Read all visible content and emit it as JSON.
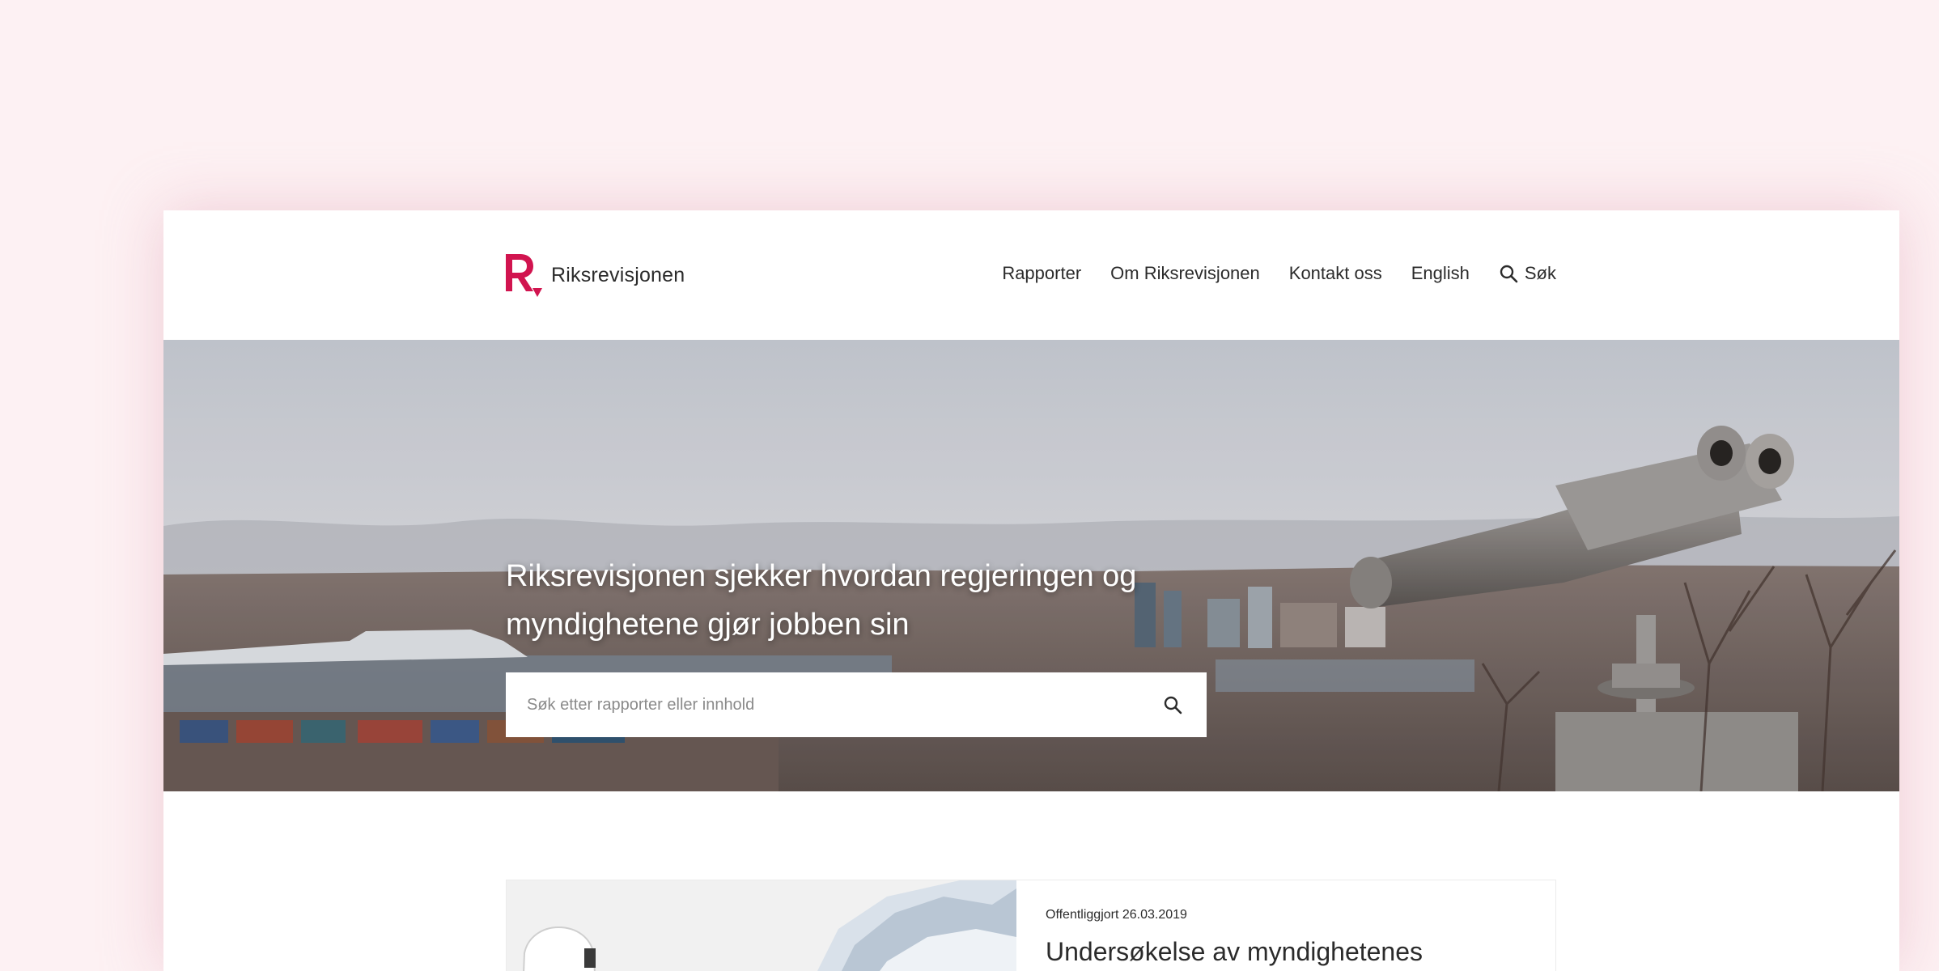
{
  "brand": {
    "name": "Riksrevisjonen",
    "accent_color": "#d1144f"
  },
  "nav": {
    "items": [
      {
        "label": "Rapporter"
      },
      {
        "label": "Om Riksrevisjonen"
      },
      {
        "label": "Kontakt oss"
      },
      {
        "label": "English"
      }
    ],
    "search_label": "Søk",
    "search_icon": "search-icon"
  },
  "hero": {
    "title": "Riksrevisjonen sjekker hvordan regjeringen og myndighetene gjør jobben sin",
    "search_placeholder": "Søk etter rapporter eller innhold",
    "search_icon": "search-icon"
  },
  "featured_report": {
    "published": "Offentliggjort 26.03.2019",
    "title": "Undersøkelse av myndighetenes"
  }
}
